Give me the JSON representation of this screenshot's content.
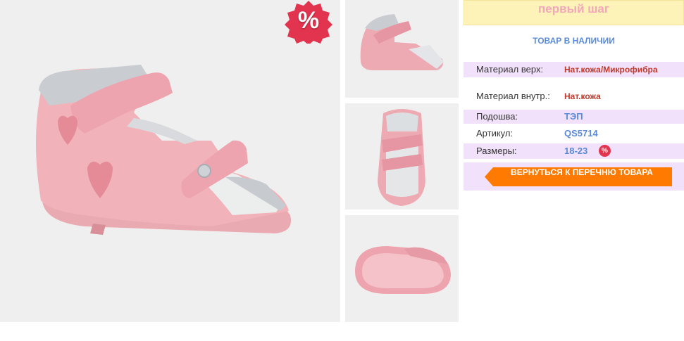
{
  "product": {
    "sale_badge": "%",
    "brand": "первый шаг",
    "stock": "ТОВАР В НАЛИЧИИ",
    "specs": [
      {
        "label": "Материал верх:",
        "value": "Нат.кожа/Микрофибра"
      },
      {
        "label": "Материал внутр.:",
        "value": "Нат.кожа"
      },
      {
        "label": "Подошва:",
        "value": "ТЭП"
      },
      {
        "label": "Артикул:",
        "value": "QS5714"
      },
      {
        "label": "Размеры:",
        "value": "18-23"
      }
    ],
    "sizes_sale_badge": "%",
    "back_button": "ВЕРНУТЬСЯ К ПЕРЕЧНЮ ТОВАРА"
  },
  "colors": {
    "accent_orange": "#ff7a00",
    "sale_red": "#e2334f",
    "brand_pink": "#f3a8b9",
    "banner_yellow": "#fdf2b8",
    "row_lilac": "#f2e1fa",
    "link_blue": "#5b8bd6"
  }
}
